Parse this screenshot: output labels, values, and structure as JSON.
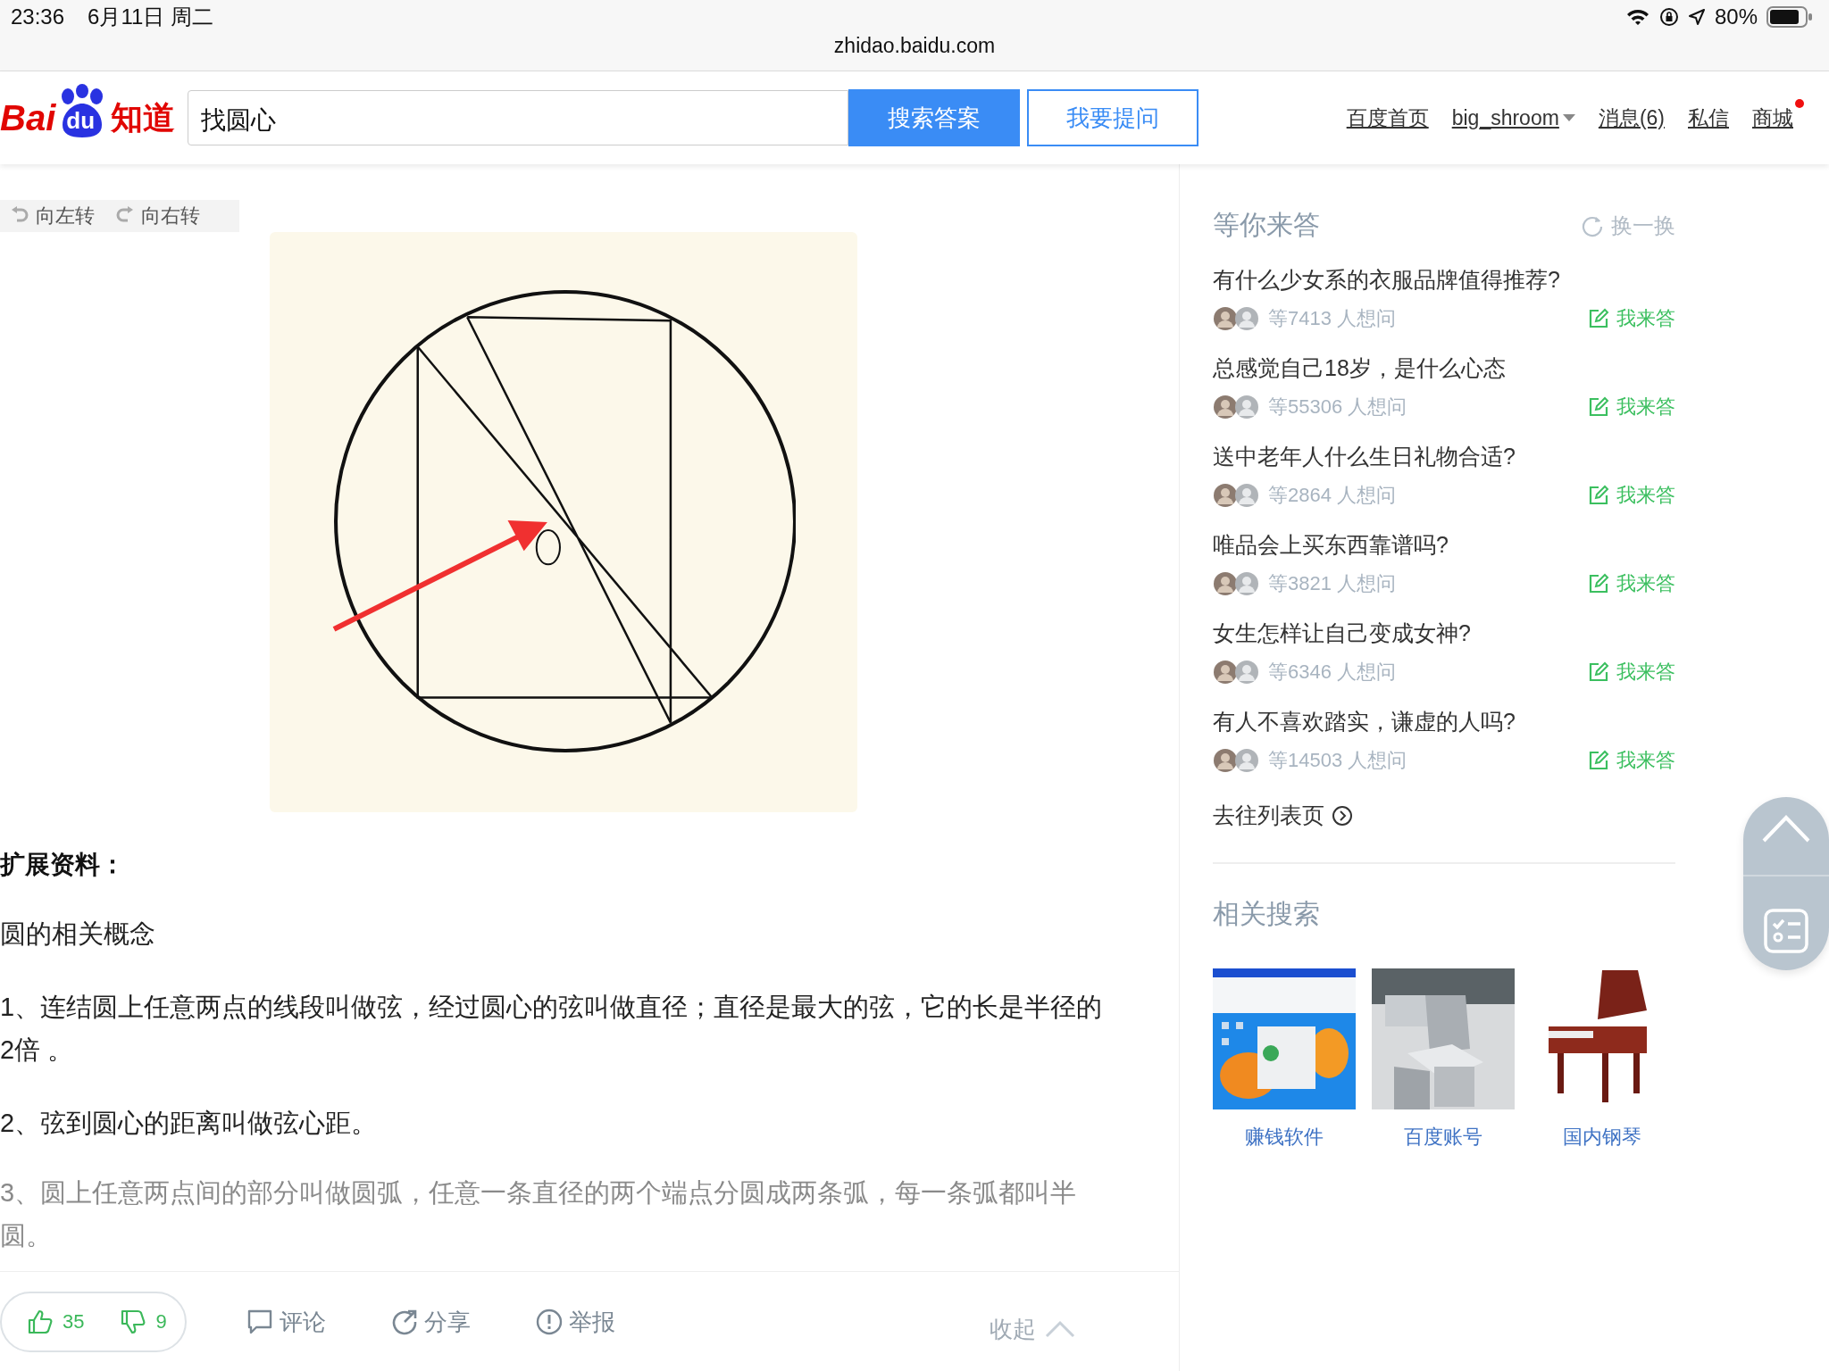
{
  "status_bar": {
    "time": "23:36",
    "date": "6月11日 周二",
    "battery": "80%"
  },
  "address_bar": {
    "url": "zhidao.baidu.com"
  },
  "header": {
    "logo": {
      "latin": "Bai",
      "badge": "du",
      "cn": "知道"
    },
    "search": {
      "value": "找圆心"
    },
    "buttons": [
      {
        "label": "搜索答案",
        "kind": "primary"
      },
      {
        "label": "我要提问",
        "kind": "outline"
      }
    ],
    "nav": [
      {
        "label": "百度首页",
        "dropdown": false,
        "dot": false
      },
      {
        "label": "big_shroom",
        "dropdown": true,
        "dot": false
      },
      {
        "label": "消息(6)",
        "dropdown": false,
        "dot": false
      },
      {
        "label": "私信",
        "dropdown": false,
        "dot": false
      },
      {
        "label": "商城",
        "dropdown": false,
        "dot": true
      }
    ]
  },
  "viewer": {
    "rotate": [
      {
        "label": "向左转",
        "kind": "left"
      },
      {
        "label": "向右转",
        "kind": "right"
      }
    ]
  },
  "article": {
    "heading": "扩展资料：",
    "paragraphs": [
      "圆的相关概念",
      "1、连结圆上任意两点的线段叫做弦，经过圆心的弦叫做直径；直径是最大的弦，它的长是半径的2倍 。",
      "2、弦到圆心的距离叫做弦心距。",
      "3、圆上任意两点间的部分叫做圆弧，任意一条直径的两个端点分圆成两条弧，每一条弧都叫半圆。"
    ]
  },
  "action_bar": {
    "likes": "35",
    "dislikes": "9",
    "actions": [
      {
        "label": "评论",
        "kind": "comment"
      },
      {
        "label": "分享",
        "kind": "share"
      },
      {
        "label": "举报",
        "kind": "report"
      }
    ],
    "collapse": "收起"
  },
  "sidebar": {
    "title": "等你来答",
    "refresh": "换一换",
    "questions": [
      {
        "title": "有什么少女系的衣服品牌值得推荐?",
        "asks": "等7413 人想问",
        "answer": "我来答"
      },
      {
        "title": "总感觉自己18岁，是什么心态",
        "asks": "等55306 人想问",
        "answer": "我来答"
      },
      {
        "title": "送中老年人什么生日礼物合适?",
        "asks": "等2864 人想问",
        "answer": "我来答"
      },
      {
        "title": "唯品会上买东西靠谱吗?",
        "asks": "等3821 人想问",
        "answer": "我来答"
      },
      {
        "title": "女生怎样让自己变成女神?",
        "asks": "等6346 人想问",
        "answer": "我来答"
      },
      {
        "title": "有人不喜欢踏实，谦虚的人吗?",
        "asks": "等14503 人想问",
        "answer": "我来答"
      }
    ],
    "more": "去往列表页",
    "related": {
      "title": "相关搜索",
      "items": [
        {
          "label": "赚钱软件",
          "kind": "desktop"
        },
        {
          "label": "百度账号",
          "kind": "metal"
        },
        {
          "label": "国内钢琴",
          "kind": "piano"
        }
      ]
    }
  }
}
